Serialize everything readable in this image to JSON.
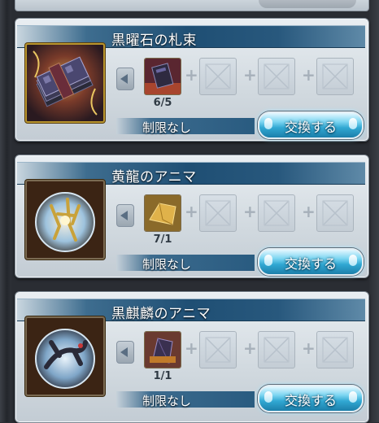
{
  "cards": [
    {
      "title": "黒曜石の札束",
      "item_icon": "obsidian-wad-icon",
      "material_icon": "obsidian-fragment-icon",
      "material_count": "6/5",
      "limit": "制限なし",
      "exchange_label": "交換する"
    },
    {
      "title": "黄龍のアニマ",
      "item_icon": "huanglong-anima-icon",
      "material_icon": "gold-brick-icon",
      "material_count": "7/1",
      "limit": "制限なし",
      "exchange_label": "交換する"
    },
    {
      "title": "黒麒麟のアニマ",
      "item_icon": "qilin-anima-icon",
      "material_icon": "black-shard-icon",
      "material_count": "1/1",
      "limit": "制限なし",
      "exchange_label": "交換する"
    }
  ],
  "colors": {
    "title_bar": "#1f4f74",
    "exchange_button": "#31a8d3",
    "portrait_frame": "#b8952e"
  }
}
